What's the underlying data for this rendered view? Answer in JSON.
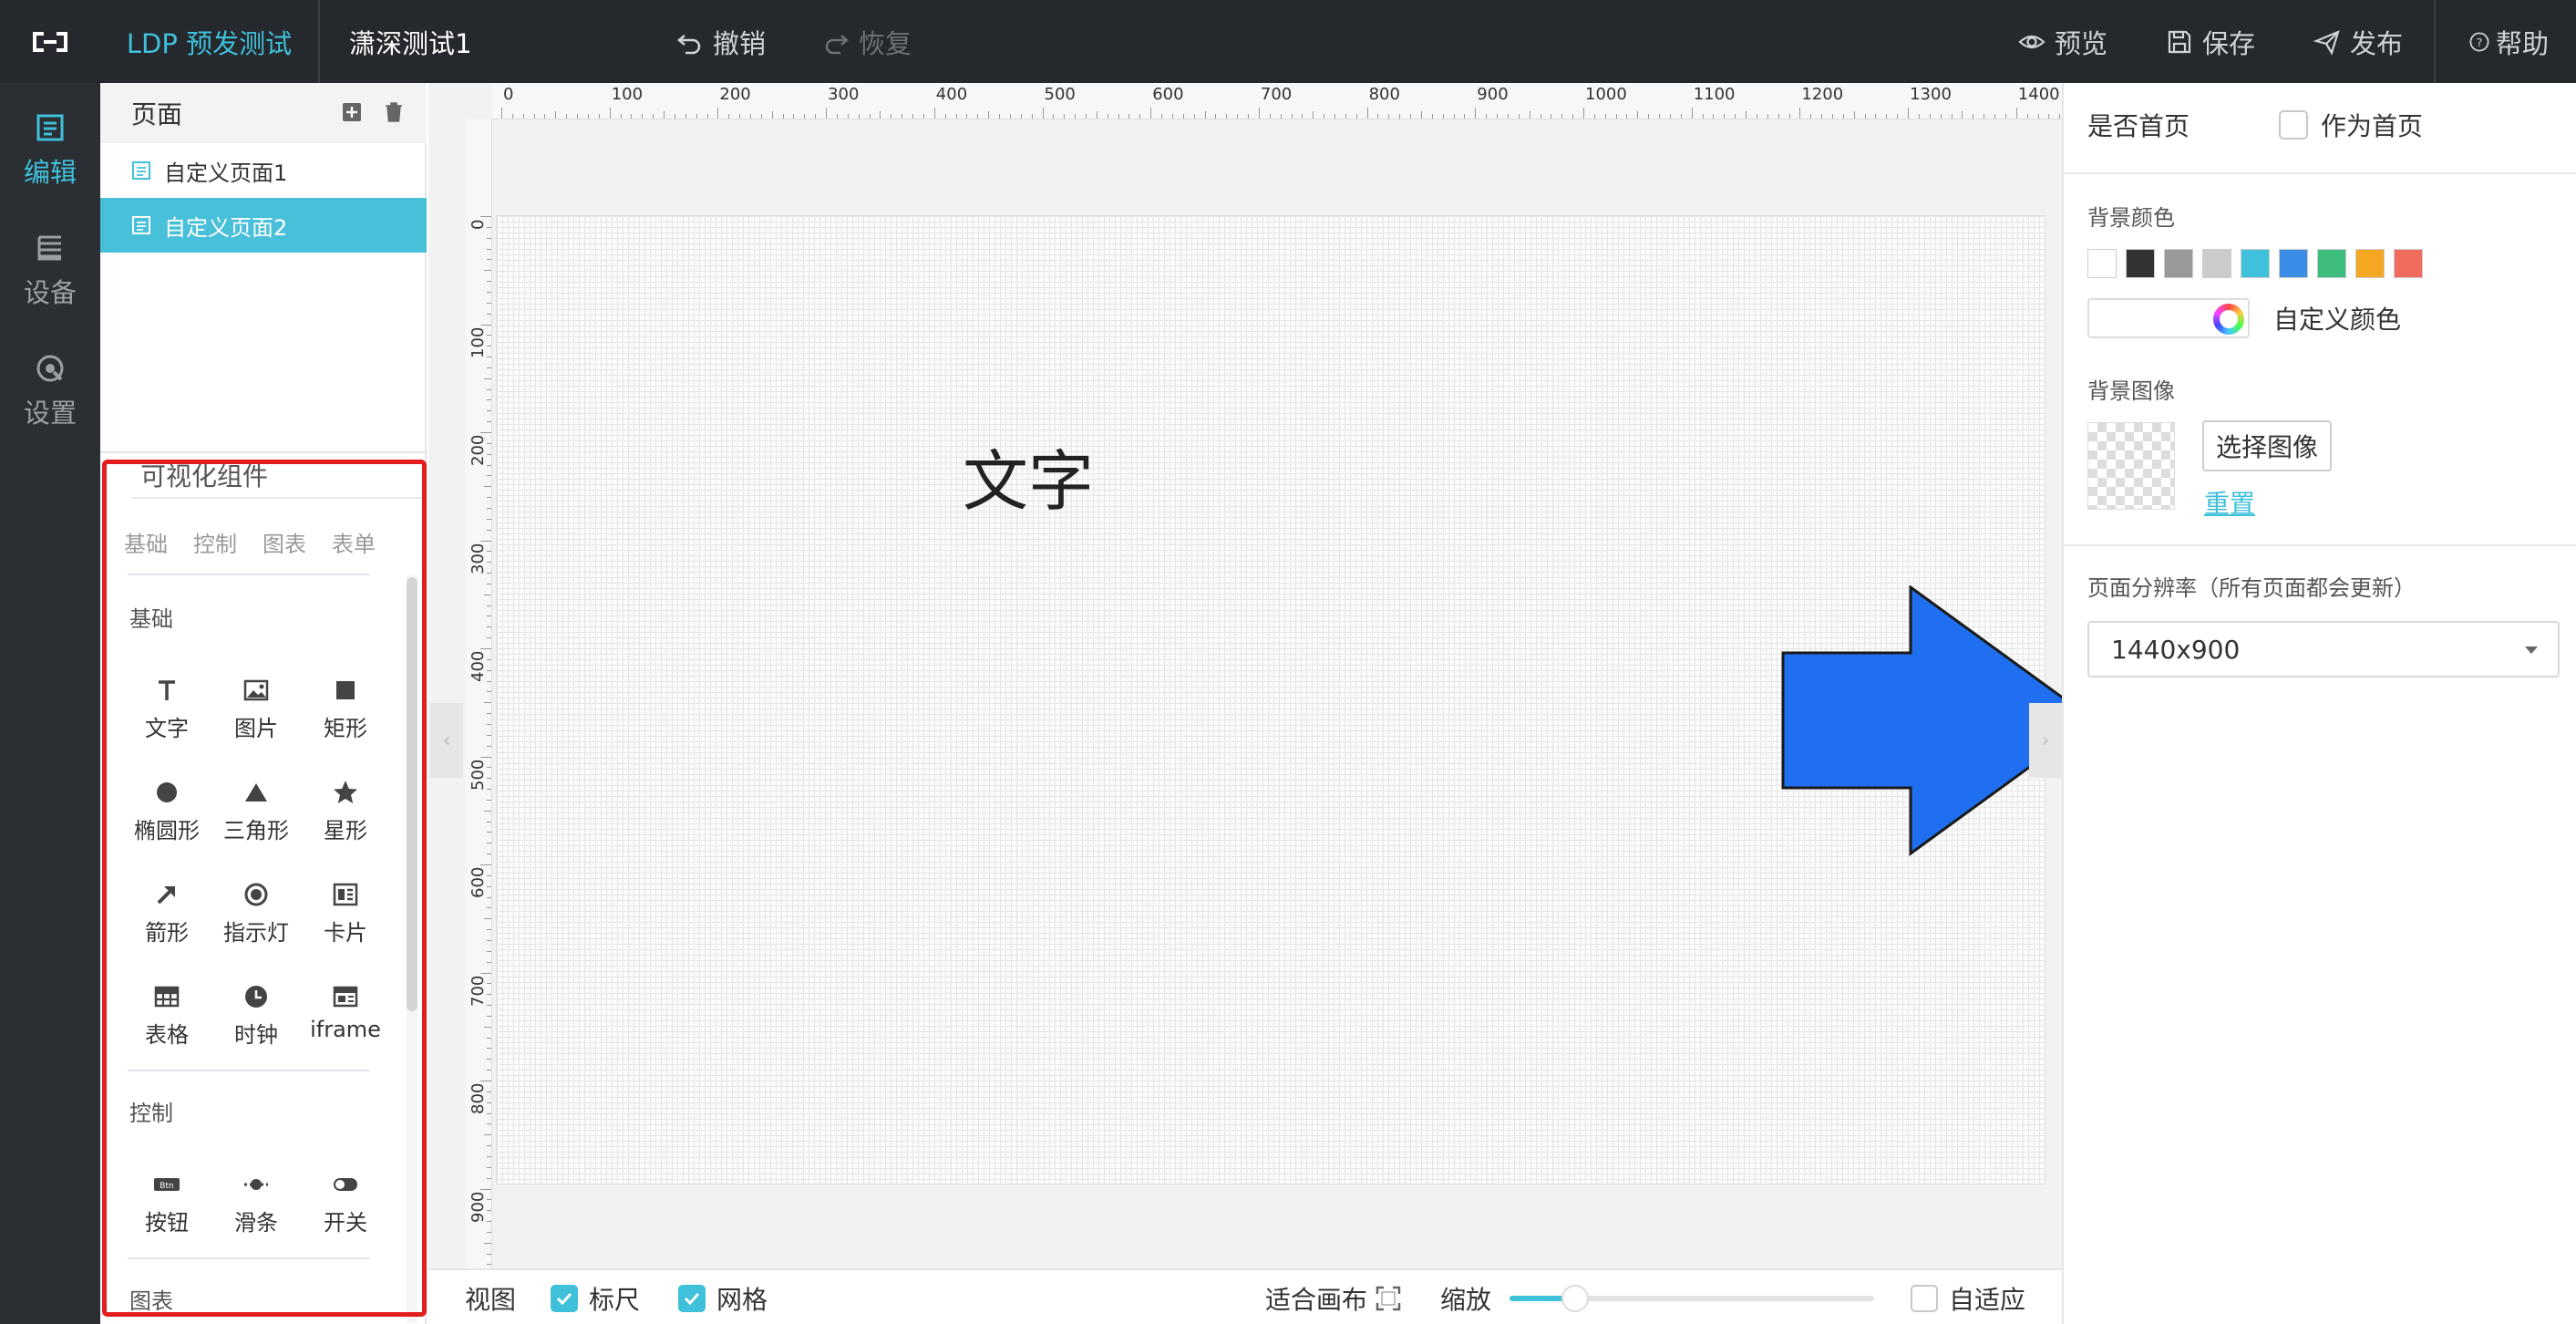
{
  "topbar": {
    "project_name": "LDP 预发测试",
    "page_title": "潇深测试1",
    "undo_label": "撤销",
    "redo_label": "恢复",
    "preview_label": "预览",
    "save_label": "保存",
    "publish_label": "发布",
    "help_label": "帮助"
  },
  "nav": {
    "edit": "编辑",
    "device": "设备",
    "settings": "设置"
  },
  "pages": {
    "header": "页面",
    "items": [
      {
        "label": "自定义页面1",
        "active": false
      },
      {
        "label": "自定义页面2",
        "active": true
      }
    ]
  },
  "components": {
    "title": "可视化组件",
    "tabs": [
      "基础",
      "控制",
      "图表",
      "表单"
    ],
    "sections": {
      "basic": "基础",
      "control": "控制",
      "chart": "图表"
    },
    "basic_items": [
      "文字",
      "图片",
      "矩形",
      "椭圆形",
      "三角形",
      "星形",
      "箭形",
      "指示灯",
      "卡片",
      "表格",
      "时钟",
      "iframe"
    ],
    "control_items": [
      "按钮",
      "滑条",
      "开关"
    ],
    "btn_glyph": "Btn"
  },
  "ruler": {
    "h_labels": [
      "0",
      "100",
      "200",
      "300",
      "400",
      "500",
      "600",
      "700",
      "800",
      "900",
      "1000",
      "1100",
      "1200",
      "1300",
      "1400"
    ],
    "v_labels": [
      "0",
      "100",
      "200",
      "300",
      "400",
      "500",
      "600",
      "700",
      "800",
      "900"
    ]
  },
  "canvas": {
    "text_widget": "文字",
    "arrow_color": "#1f6ff0"
  },
  "bottombar": {
    "view_label": "视图",
    "ruler_label": "标尺",
    "ruler_checked": true,
    "grid_label": "网格",
    "grid_checked": true,
    "fit_canvas_label": "适合画布",
    "zoom_label": "缩放",
    "zoom_fraction": 0.18,
    "adaptive_label": "自适应",
    "adaptive_checked": false
  },
  "rightpanel": {
    "is_home_label": "是否首页",
    "as_home_label": "作为首页",
    "bg_color_label": "背景颜色",
    "swatches": [
      "#ffffff",
      "#333333",
      "#999999",
      "#cccccc",
      "#3fc0db",
      "#3a8ee6",
      "#3dbd7d",
      "#f5a623",
      "#f16c5c"
    ],
    "custom_color_label": "自定义颜色",
    "bg_image_label": "背景图像",
    "choose_image_label": "选择图像",
    "reset_label": "重置",
    "resolution_label": "页面分辨率（所有页面都会更新）",
    "resolution_value": "1440x900"
  },
  "accent_color": "#3fc0db"
}
